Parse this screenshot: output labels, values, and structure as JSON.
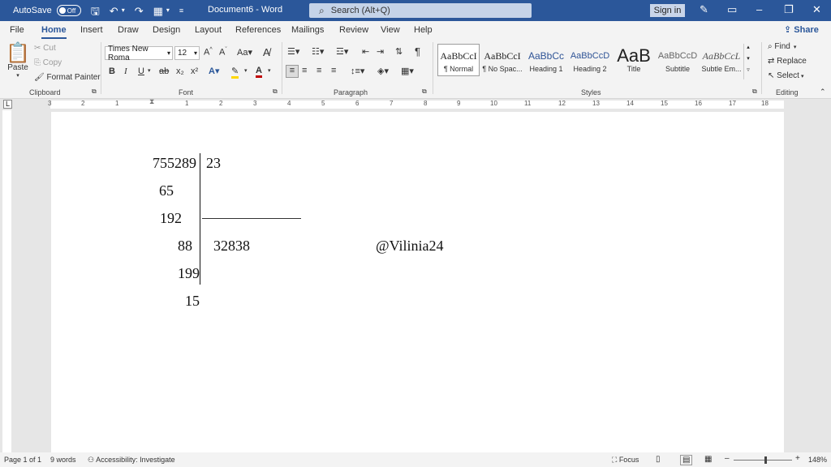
{
  "titlebar": {
    "autosave_label": "AutoSave",
    "autosave_state": "Off",
    "document_title": "Document6 - Word",
    "search_placeholder": "Search (Alt+Q)",
    "signin_label": "Sign in"
  },
  "menu": {
    "tabs": [
      "File",
      "Home",
      "Insert",
      "Draw",
      "Design",
      "Layout",
      "References",
      "Mailings",
      "Review",
      "View",
      "Help"
    ],
    "active": "Home",
    "share_label": "Share"
  },
  "ribbon": {
    "clipboard": {
      "paste_label": "Paste",
      "cut_label": "Cut",
      "copy_label": "Copy",
      "format_painter_label": "Format Painter",
      "group_label": "Clipboard"
    },
    "font": {
      "font_name": "Times New Roma",
      "font_size": "12",
      "bold": "B",
      "italic": "I",
      "underline": "U",
      "strike": "ab",
      "subscript": "x₂",
      "superscript": "x²",
      "group_label": "Font"
    },
    "paragraph": {
      "group_label": "Paragraph"
    },
    "styles": {
      "items": [
        {
          "sample": "AaBbCcI",
          "name": "¶ Normal"
        },
        {
          "sample": "AaBbCcI",
          "name": "¶ No Spac..."
        },
        {
          "sample": "AaBbCc",
          "name": "Heading 1"
        },
        {
          "sample": "AaBbCcD",
          "name": "Heading 2"
        },
        {
          "sample": "AaB",
          "name": "Title"
        },
        {
          "sample": "AaBbCcD",
          "name": "Subtitle"
        },
        {
          "sample": "AaBbCcL",
          "name": "Subtle Em..."
        }
      ],
      "group_label": "Styles"
    },
    "editing": {
      "find_label": "Find",
      "replace_label": "Replace",
      "select_label": "Select",
      "group_label": "Editing"
    },
    "colors": {
      "accent": "#2b579a",
      "highlight": "#ffd700",
      "font_color": "#c00000"
    }
  },
  "ruler": {
    "numbers": [
      "3",
      "2",
      "1",
      "1",
      "2",
      "3",
      "4",
      "5",
      "6",
      "7",
      "8",
      "9",
      "10",
      "11",
      "12",
      "13",
      "14",
      "15",
      "16",
      "17",
      "18"
    ]
  },
  "document": {
    "dividend": "755289",
    "divisor": "23",
    "step1": "65",
    "step2": "192",
    "step3": "88",
    "quotient": "32838",
    "step4": "199",
    "remainder": "15",
    "signature": "@Vilinia24"
  },
  "status": {
    "page": "Page 1 of 1",
    "words": "9 words",
    "accessibility": "Accessibility: Investigate",
    "focus": "Focus",
    "zoom": "148%"
  }
}
